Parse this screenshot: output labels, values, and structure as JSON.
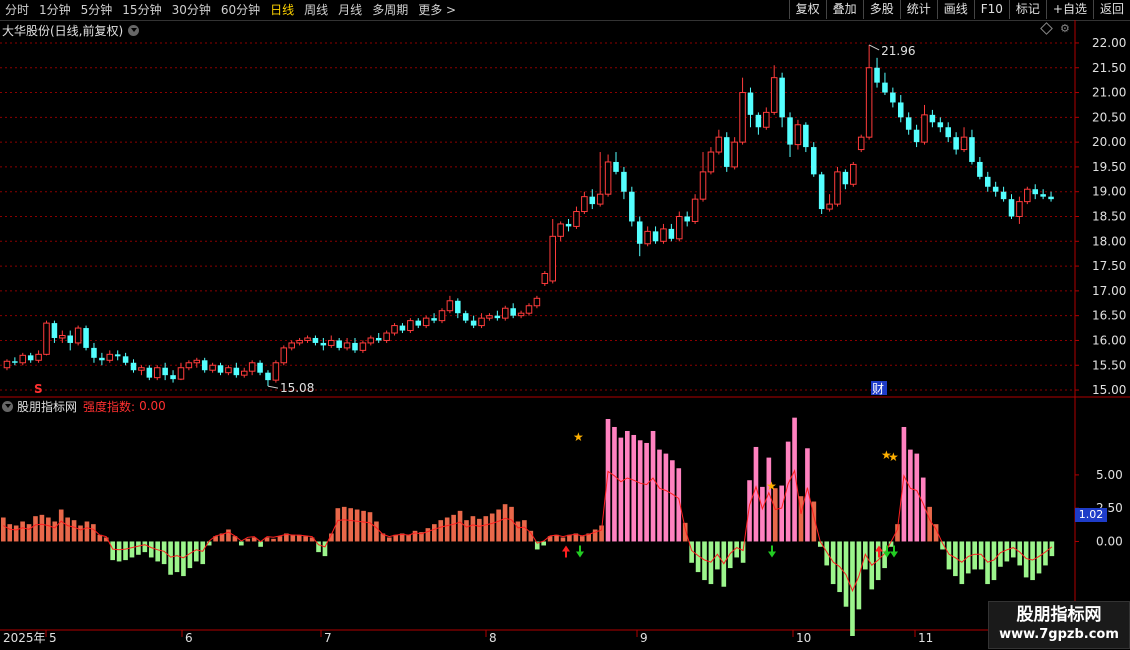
{
  "toolbar": {
    "periods": [
      "分时",
      "1分钟",
      "5分钟",
      "15分钟",
      "30分钟",
      "60分钟",
      "日线",
      "周线",
      "月线",
      "多周期",
      "更多"
    ],
    "active_period": "日线",
    "more_arrow": ">",
    "buttons": [
      "复权",
      "叠加",
      "多股",
      "统计",
      "画线",
      "F10",
      "标记",
      "+自选",
      "返回"
    ]
  },
  "chart_title": "大华股份(日线,前复权)",
  "price_axis": [
    "22.00",
    "21.50",
    "21.00",
    "20.50",
    "20.00",
    "19.50",
    "19.00",
    "18.50",
    "18.00",
    "17.50",
    "17.00",
    "16.50",
    "16.00",
    "15.50",
    "15.00"
  ],
  "high_label": "21.96",
  "low_label": "15.08",
  "markers": {
    "s_marker": "S",
    "cai_marker": "财"
  },
  "indicator": {
    "name": "股朋指标网",
    "label": "强度指数:",
    "value": "0.00",
    "axis": [
      "5.00",
      "2.50",
      "0.00"
    ],
    "current_value": "1.02"
  },
  "date_axis": {
    "year": "2025年",
    "months": [
      "5",
      "6",
      "7",
      "8",
      "9",
      "10",
      "11"
    ]
  },
  "watermark": {
    "line1": "股朋指标网",
    "line2": "www.7gpzb.com"
  },
  "colors": {
    "up": "#ff3c3c",
    "down": "#54ffff",
    "grid": "#8b0000",
    "pos_bar": "#e8684a",
    "strong_bar": "#ff82c0",
    "neg_bar": "#9cf58c",
    "active": "#ffd400"
  },
  "chart_data": {
    "type": "candlestick",
    "ylim": [
      14.9,
      22.1
    ],
    "candles": [
      [
        15.45,
        15.58,
        15.4,
        15.62
      ],
      [
        15.58,
        15.55,
        15.5,
        15.66
      ],
      [
        15.55,
        15.7,
        15.5,
        15.75
      ],
      [
        15.7,
        15.6,
        15.55,
        15.75
      ],
      [
        15.6,
        15.72,
        15.55,
        15.8
      ],
      [
        15.72,
        16.35,
        15.7,
        16.4
      ],
      [
        16.35,
        16.05,
        15.95,
        16.4
      ],
      [
        16.05,
        16.1,
        15.95,
        16.2
      ],
      [
        16.1,
        15.95,
        15.8,
        16.2
      ],
      [
        15.95,
        16.25,
        15.9,
        16.3
      ],
      [
        16.25,
        15.85,
        15.8,
        16.3
      ],
      [
        15.85,
        15.65,
        15.55,
        15.95
      ],
      [
        15.65,
        15.6,
        15.5,
        15.75
      ],
      [
        15.6,
        15.72,
        15.55,
        15.8
      ],
      [
        15.72,
        15.68,
        15.6,
        15.8
      ],
      [
        15.68,
        15.55,
        15.5,
        15.75
      ],
      [
        15.55,
        15.4,
        15.35,
        15.62
      ],
      [
        15.4,
        15.45,
        15.3,
        15.5
      ],
      [
        15.45,
        15.25,
        15.2,
        15.5
      ],
      [
        15.25,
        15.45,
        15.2,
        15.5
      ],
      [
        15.45,
        15.3,
        15.2,
        15.55
      ],
      [
        15.3,
        15.22,
        15.15,
        15.4
      ],
      [
        15.22,
        15.45,
        15.2,
        15.55
      ],
      [
        15.45,
        15.55,
        15.4,
        15.6
      ],
      [
        15.55,
        15.6,
        15.45,
        15.65
      ],
      [
        15.6,
        15.4,
        15.35,
        15.65
      ],
      [
        15.4,
        15.5,
        15.35,
        15.55
      ],
      [
        15.5,
        15.35,
        15.3,
        15.55
      ],
      [
        15.35,
        15.45,
        15.3,
        15.5
      ],
      [
        15.45,
        15.3,
        15.25,
        15.55
      ],
      [
        15.3,
        15.38,
        15.25,
        15.45
      ],
      [
        15.38,
        15.55,
        15.3,
        15.6
      ],
      [
        15.55,
        15.35,
        15.3,
        15.6
      ],
      [
        15.35,
        15.2,
        15.08,
        15.4
      ],
      [
        15.2,
        15.55,
        15.15,
        15.6
      ],
      [
        15.55,
        15.85,
        15.5,
        15.9
      ],
      [
        15.85,
        15.95,
        15.8,
        16.0
      ],
      [
        15.95,
        16.0,
        15.9,
        16.05
      ],
      [
        16.0,
        16.05,
        15.95,
        16.1
      ],
      [
        16.05,
        15.95,
        15.9,
        16.1
      ],
      [
        15.95,
        15.9,
        15.8,
        16.05
      ],
      [
        15.9,
        16.0,
        15.85,
        16.1
      ],
      [
        16.0,
        15.85,
        15.8,
        16.05
      ],
      [
        15.85,
        15.95,
        15.8,
        16.05
      ],
      [
        15.95,
        15.8,
        15.75,
        16.05
      ],
      [
        15.8,
        15.95,
        15.75,
        16.0
      ],
      [
        15.95,
        16.05,
        15.9,
        16.1
      ],
      [
        16.05,
        16.0,
        15.95,
        16.15
      ],
      [
        16.0,
        16.15,
        15.95,
        16.2
      ],
      [
        16.15,
        16.3,
        16.1,
        16.35
      ],
      [
        16.3,
        16.2,
        16.15,
        16.35
      ],
      [
        16.2,
        16.4,
        16.15,
        16.45
      ],
      [
        16.4,
        16.3,
        16.25,
        16.45
      ],
      [
        16.3,
        16.45,
        16.25,
        16.5
      ],
      [
        16.45,
        16.4,
        16.35,
        16.55
      ],
      [
        16.4,
        16.6,
        16.35,
        16.65
      ],
      [
        16.6,
        16.8,
        16.55,
        16.9
      ],
      [
        16.8,
        16.55,
        16.45,
        16.85
      ],
      [
        16.55,
        16.4,
        16.35,
        16.6
      ],
      [
        16.4,
        16.3,
        16.25,
        16.5
      ],
      [
        16.3,
        16.45,
        16.25,
        16.55
      ],
      [
        16.45,
        16.5,
        16.4,
        16.55
      ],
      [
        16.5,
        16.45,
        16.4,
        16.6
      ],
      [
        16.45,
        16.65,
        16.4,
        16.7
      ],
      [
        16.65,
        16.5,
        16.45,
        16.75
      ],
      [
        16.5,
        16.55,
        16.45,
        16.6
      ],
      [
        16.55,
        16.7,
        16.5,
        16.75
      ],
      [
        16.7,
        16.85,
        16.65,
        16.9
      ],
      [
        17.15,
        17.35,
        17.1,
        17.4
      ],
      [
        17.2,
        18.1,
        17.15,
        18.45
      ],
      [
        18.1,
        18.35,
        18.0,
        18.4
      ],
      [
        18.35,
        18.3,
        18.2,
        18.45
      ],
      [
        18.3,
        18.6,
        18.25,
        18.7
      ],
      [
        18.6,
        18.9,
        18.55,
        19.0
      ],
      [
        18.9,
        18.75,
        18.65,
        19.05
      ],
      [
        18.75,
        18.95,
        18.7,
        19.8
      ],
      [
        18.95,
        19.6,
        18.9,
        19.75
      ],
      [
        19.6,
        19.4,
        19.35,
        19.8
      ],
      [
        19.4,
        19.0,
        18.85,
        19.5
      ],
      [
        19.0,
        18.4,
        18.3,
        19.1
      ],
      [
        18.4,
        17.95,
        17.7,
        18.5
      ],
      [
        17.95,
        18.2,
        17.9,
        18.3
      ],
      [
        18.2,
        18.0,
        17.95,
        18.3
      ],
      [
        18.0,
        18.25,
        17.95,
        18.35
      ],
      [
        18.25,
        18.05,
        18.0,
        18.35
      ],
      [
        18.05,
        18.5,
        18.0,
        18.6
      ],
      [
        18.5,
        18.4,
        18.3,
        18.6
      ],
      [
        18.4,
        18.85,
        18.35,
        18.95
      ],
      [
        18.85,
        19.4,
        18.8,
        19.8
      ],
      [
        19.4,
        19.8,
        19.35,
        19.9
      ],
      [
        19.8,
        20.1,
        19.75,
        20.25
      ],
      [
        20.1,
        19.5,
        19.4,
        20.2
      ],
      [
        19.5,
        20.0,
        19.45,
        20.1
      ],
      [
        20.0,
        21.0,
        19.95,
        21.3
      ],
      [
        21.0,
        20.55,
        20.3,
        21.1
      ],
      [
        20.55,
        20.3,
        20.15,
        20.6
      ],
      [
        20.3,
        20.6,
        20.25,
        20.7
      ],
      [
        20.6,
        21.3,
        20.55,
        21.55
      ],
      [
        21.3,
        20.5,
        20.3,
        21.4
      ],
      [
        20.5,
        19.95,
        19.7,
        20.6
      ],
      [
        19.95,
        20.35,
        19.85,
        20.45
      ],
      [
        20.35,
        19.9,
        19.8,
        20.4
      ],
      [
        19.9,
        19.35,
        19.3,
        20.0
      ],
      [
        19.35,
        18.65,
        18.55,
        19.4
      ],
      [
        18.65,
        18.75,
        18.6,
        18.95
      ],
      [
        18.75,
        19.4,
        18.7,
        19.5
      ],
      [
        19.4,
        19.15,
        19.05,
        19.45
      ],
      [
        19.15,
        19.55,
        19.1,
        19.6
      ],
      [
        19.85,
        20.1,
        19.8,
        20.15
      ],
      [
        20.1,
        21.5,
        20.05,
        21.96
      ],
      [
        21.5,
        21.2,
        21.1,
        21.7
      ],
      [
        21.2,
        21.0,
        20.95,
        21.4
      ],
      [
        21.0,
        20.8,
        20.7,
        21.1
      ],
      [
        20.8,
        20.5,
        20.4,
        20.95
      ],
      [
        20.5,
        20.25,
        20.15,
        20.6
      ],
      [
        20.25,
        20.0,
        19.9,
        20.35
      ],
      [
        20.0,
        20.55,
        19.95,
        20.75
      ],
      [
        20.55,
        20.4,
        20.3,
        20.65
      ],
      [
        20.4,
        20.3,
        20.2,
        20.5
      ],
      [
        20.3,
        20.1,
        20.0,
        20.4
      ],
      [
        20.1,
        19.85,
        19.75,
        20.2
      ],
      [
        19.85,
        20.1,
        19.8,
        20.3
      ],
      [
        20.1,
        19.6,
        19.55,
        20.25
      ],
      [
        19.6,
        19.3,
        19.25,
        19.7
      ],
      [
        19.3,
        19.1,
        19.0,
        19.4
      ],
      [
        19.1,
        19.0,
        18.9,
        19.2
      ],
      [
        19.0,
        18.85,
        18.8,
        19.1
      ],
      [
        18.85,
        18.5,
        18.45,
        18.95
      ],
      [
        18.5,
        18.8,
        18.35,
        18.9
      ],
      [
        18.8,
        19.05,
        18.75,
        19.1
      ],
      [
        19.05,
        18.95,
        18.85,
        19.15
      ],
      [
        18.95,
        18.9,
        18.85,
        19.05
      ],
      [
        18.9,
        18.85,
        18.8,
        19.0
      ]
    ],
    "indicator_bars": [
      1.8,
      1.3,
      1.2,
      1.5,
      1.3,
      1.9,
      2.0,
      1.8,
      1.5,
      2.4,
      1.8,
      1.6,
      1.2,
      1.5,
      1.3,
      0.5,
      0.3,
      -1.4,
      -1.5,
      -1.4,
      -1.2,
      -1.0,
      -0.8,
      -1.2,
      -1.5,
      -1.7,
      -2.5,
      -2.3,
      -2.6,
      -2.0,
      -1.5,
      -1.7,
      -0.3,
      0.4,
      0.6,
      0.9,
      0.4,
      -0.3,
      0.2,
      0.3,
      -0.4,
      0.3,
      0.2,
      0.4,
      0.6,
      0.5,
      0.5,
      0.4,
      0.3,
      -0.8,
      -1.1,
      0.6,
      2.5,
      2.6,
      2.5,
      2.4,
      2.3,
      2.2,
      1.5,
      0.6,
      0.3,
      0.5,
      0.6,
      0.5,
      0.8,
      0.7,
      1.0,
      1.3,
      1.6,
      1.8,
      2.0,
      2.3,
      1.6,
      1.9,
      1.7,
      1.9,
      2.1,
      2.4,
      2.8,
      2.6,
      1.5,
      1.6,
      0.8,
      -0.6,
      -0.3,
      0.4,
      0.5,
      0.3,
      0.5,
      0.6,
      0.4,
      0.6,
      0.9,
      1.2,
      9.2,
      8.6,
      7.8,
      8.3,
      8.0,
      7.6,
      7.4,
      8.3,
      6.9,
      6.6,
      6.1,
      5.5,
      1.4,
      -1.6,
      -2.3,
      -2.9,
      -3.2,
      -2.1,
      -3.4,
      -2.0,
      -1.2,
      -1.6,
      4.6,
      7.1,
      4.1,
      6.3,
      4.0,
      4.2,
      7.5,
      9.3,
      3.4,
      7.0,
      3.0,
      -0.4,
      -1.8,
      -3.2,
      -3.8,
      -4.9,
      -7.1,
      -5.1,
      -2.1,
      -3.6,
      -2.9,
      -2.0,
      -0.4,
      1.3,
      8.6,
      6.9,
      6.6,
      4.8,
      2.6,
      1.3,
      -0.6,
      -2.1,
      -2.6,
      -3.2,
      -2.4,
      -2.1,
      -2.1,
      -3.2,
      -2.9,
      -1.9,
      -1.5,
      -1.2,
      -1.8,
      -2.7,
      -2.9,
      -2.4,
      -1.8,
      -1.1
    ],
    "indicator_ylim": [
      -6.5,
      9.5
    ]
  }
}
